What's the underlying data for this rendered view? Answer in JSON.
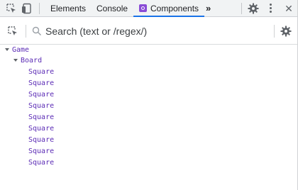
{
  "tabs": {
    "elements": "Elements",
    "console": "Console",
    "components": "Components",
    "more": "»"
  },
  "search": {
    "placeholder": "Search (text or /regex/)",
    "value": ""
  },
  "tree": {
    "root": "Game",
    "board": "Board",
    "squares": [
      "Square",
      "Square",
      "Square",
      "Square",
      "Square",
      "Square",
      "Square",
      "Square",
      "Square"
    ]
  },
  "colors": {
    "accent": "#1a73e8",
    "component_text": "#5b2bb5",
    "react_icon": "#8a4cd6"
  },
  "icons": [
    "inspect-element-icon",
    "device-toolbar-icon",
    "react-components-icon",
    "more-tabs-icon",
    "settings-gear-icon",
    "kebab-menu-icon",
    "select-component-icon",
    "search-icon"
  ]
}
